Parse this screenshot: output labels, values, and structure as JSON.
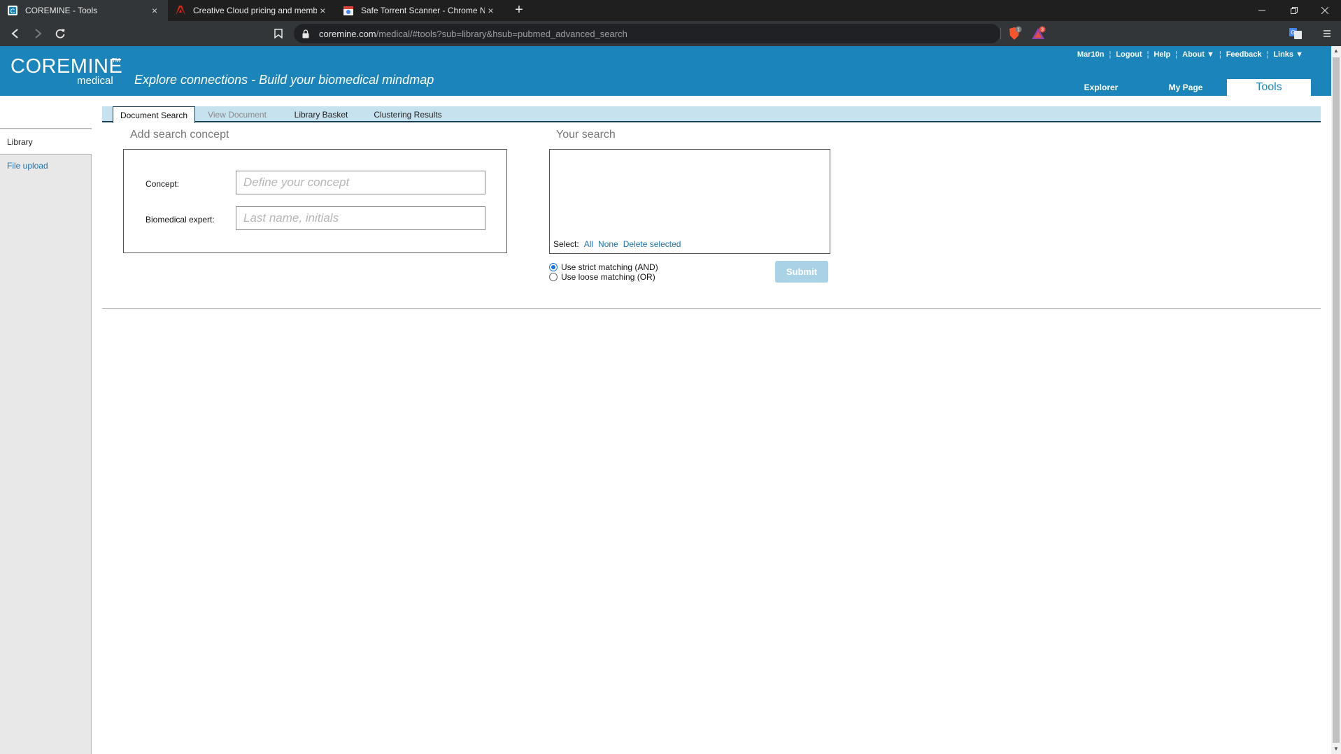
{
  "browser": {
    "tabs": [
      {
        "title": "COREMINE - Tools",
        "active": true,
        "icon": "coremine-favicon"
      },
      {
        "title": "Creative Cloud pricing and membe",
        "active": false,
        "icon": "adobe-favicon"
      },
      {
        "title": "Safe Torrent Scanner - Chrome Ne",
        "active": false,
        "icon": "chrome-webstore-favicon"
      }
    ],
    "close_glyph": "×",
    "new_tab_glyph": "+",
    "url_host": "coremine.com",
    "url_path": "/medical/#tools?sub=library&hsub=pubmed_advanced_search",
    "extensions": [
      {
        "icon": "brave-shield-icon",
        "badge": "1"
      },
      {
        "icon": "brave-rewards-icon",
        "badge": "3"
      }
    ]
  },
  "site": {
    "logo_main": "COREMINE",
    "logo_tm": "TM",
    "logo_sub": "medical",
    "tagline": "Explore connections - Build your biomedical mindmap",
    "top_links": [
      "Mar10n",
      "Logout",
      "Help",
      "About ▼",
      "Feedback",
      "Links ▼"
    ],
    "main_nav": [
      "Explorer",
      "My Page",
      "Tools"
    ],
    "colors": {
      "header_bg": "#1b85bb",
      "subtab_bg": "#c5e2ee",
      "link": "#1b73b3",
      "submit_bg": "#a9d2e6"
    }
  },
  "sidebar": {
    "items": [
      {
        "label": "Library",
        "active": true
      },
      {
        "label": "File upload",
        "active": false
      }
    ]
  },
  "subtabs": [
    {
      "label": "Document Search",
      "state": "active"
    },
    {
      "label": "View Document",
      "state": "disabled"
    },
    {
      "label": "Library Basket",
      "state": "normal"
    },
    {
      "label": "Clustering Results",
      "state": "normal"
    }
  ],
  "add_concept": {
    "title": "Add search concept",
    "concept_label": "Concept:",
    "concept_placeholder": "Define your concept",
    "expert_label": "Biomedical expert:",
    "expert_placeholder": "Last name, initials"
  },
  "your_search": {
    "title": "Your search",
    "select_label": "Select:",
    "select_all": "All",
    "select_none": "None",
    "delete_selected": "Delete selected",
    "strict_label": "Use strict matching (AND)",
    "loose_label": "Use loose matching (OR)",
    "strict_selected": true,
    "submit_label": "Submit"
  }
}
